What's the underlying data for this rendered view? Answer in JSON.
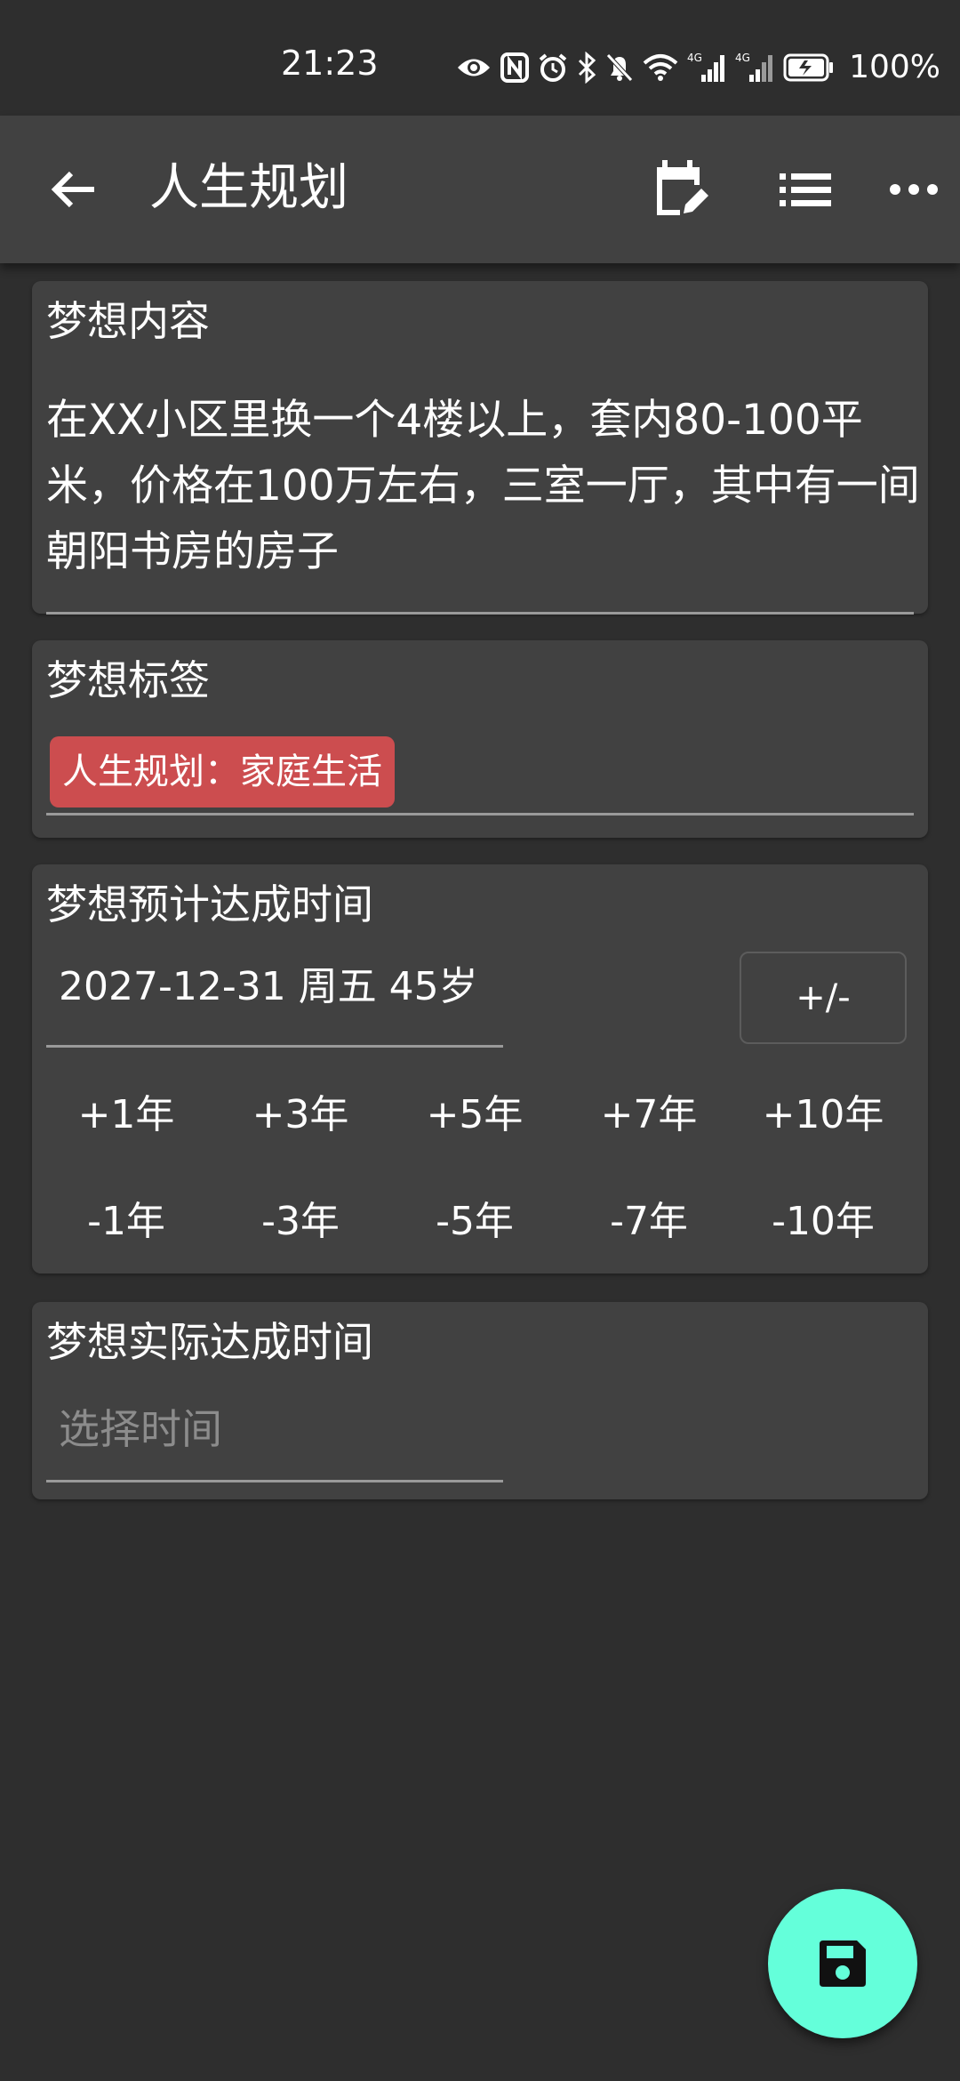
{
  "status_bar": {
    "time": "21:23",
    "battery": "100%",
    "icons": [
      "eye-icon",
      "nfc-icon",
      "alarm-icon",
      "bluetooth-icon",
      "bell-off-icon",
      "wifi-icon",
      "signal-4g-icon",
      "signal-4g-icon",
      "battery-charging-icon"
    ]
  },
  "app_bar": {
    "title": "人生规划",
    "icons": [
      "back-arrow-icon",
      "calendar-edit-icon",
      "list-icon",
      "more-icon"
    ]
  },
  "dream_content": {
    "title": "梦想内容",
    "text": "在XX小区里换一个4楼以上，套内80-100平米，价格在100万左右，三室一厅，其中有一间朝阳书房的房子"
  },
  "dream_tags": {
    "title": "梦想标签",
    "tag": "人生规划：家庭生活",
    "tag_color": "#cc4d4f"
  },
  "expected_time": {
    "title": "梦想预计达成时间",
    "value": "2027-12-31 周五 45岁",
    "toggle_label": "+/-",
    "plus_buttons": [
      "+1年",
      "+3年",
      "+5年",
      "+7年",
      "+10年"
    ],
    "minus_buttons": [
      "-1年",
      "-3年",
      "-5年",
      "-7年",
      "-10年"
    ]
  },
  "actual_time": {
    "title": "梦想实际达成时间",
    "placeholder": "选择时间"
  },
  "fab": {
    "icon": "save-icon",
    "color": "#64ffda"
  }
}
